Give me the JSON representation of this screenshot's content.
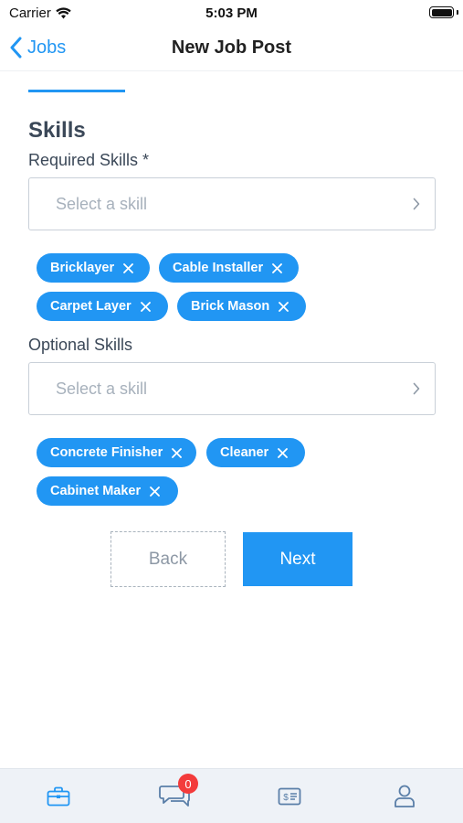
{
  "status_bar": {
    "carrier": "Carrier",
    "time": "5:03 PM"
  },
  "nav": {
    "back_label": "Jobs",
    "title": "New Job Post"
  },
  "page": {
    "section_title": "Skills",
    "progress": 0.25
  },
  "required": {
    "label": "Required Skills *",
    "placeholder": "Select a skill",
    "chips": [
      "Bricklayer",
      "Cable Installer",
      "Carpet Layer",
      "Brick Mason"
    ]
  },
  "optional": {
    "label": "Optional Skills",
    "placeholder": "Select a skill",
    "chips": [
      "Concrete Finisher",
      "Cleaner",
      "Cabinet Maker"
    ]
  },
  "buttons": {
    "back": "Back",
    "next": "Next"
  },
  "tab_bar": {
    "tabs": [
      "briefcase-icon",
      "chat-icon",
      "invoice-icon",
      "profile-icon"
    ],
    "messages_badge": "0"
  },
  "colors": {
    "accent": "#2196f3",
    "badge": "#f33b3b",
    "tab_icon": "#5a7fa8"
  }
}
